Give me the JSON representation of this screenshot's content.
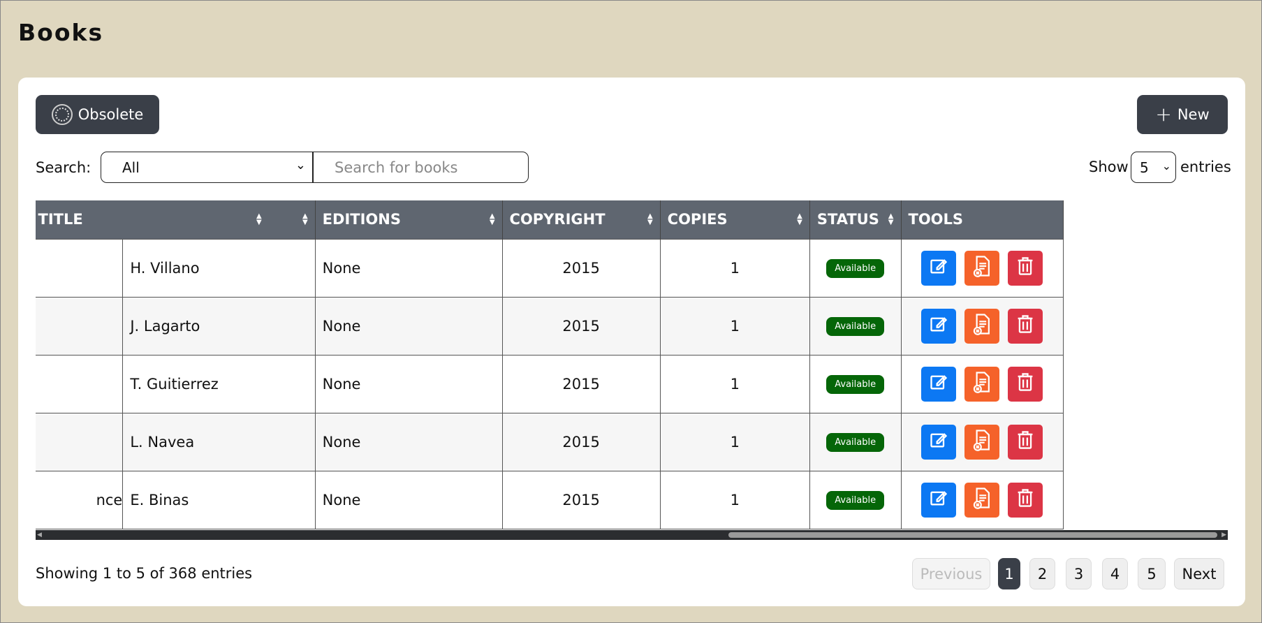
{
  "page": {
    "title": "Books"
  },
  "toolbar": {
    "obsolete_label": "Obsolete",
    "new_label": "New"
  },
  "search": {
    "label": "Search:",
    "filter_value": "All",
    "placeholder": "Search for books"
  },
  "show_entries": {
    "prefix": "Show",
    "value": "5",
    "suffix": "entries"
  },
  "table": {
    "headers": {
      "title": "TITLE",
      "editions": "EDITIONS",
      "copyright": "COPYRIGHT",
      "copies": "COPIES",
      "status": "STATUS",
      "tools": "TOOLS"
    },
    "rows": [
      {
        "title_fragment": "",
        "author": "H. Villano",
        "editions": "None",
        "copyright": "2015",
        "copies": "1",
        "status": "Available"
      },
      {
        "title_fragment": "",
        "author": "J. Lagarto",
        "editions": "None",
        "copyright": "2015",
        "copies": "1",
        "status": "Available"
      },
      {
        "title_fragment": "",
        "author": "T. Guitierrez",
        "editions": "None",
        "copyright": "2015",
        "copies": "1",
        "status": "Available"
      },
      {
        "title_fragment": "",
        "author": "L. Navea",
        "editions": "None",
        "copyright": "2015",
        "copies": "1",
        "status": "Available"
      },
      {
        "title_fragment": "nce",
        "author": "E. Binas",
        "editions": "None",
        "copyright": "2015",
        "copies": "1",
        "status": "Available"
      }
    ]
  },
  "footer": {
    "info": "Showing 1 to 5 of 368 entries",
    "pagination": {
      "previous": "Previous",
      "pages": [
        "1",
        "2",
        "3",
        "4",
        "5"
      ],
      "next": "Next",
      "current": "1"
    }
  },
  "colors": {
    "background": "#dfd7bf",
    "header": "#5f6670",
    "dark_button": "#3a3f48",
    "status_available": "#056608",
    "edit": "#0c78f3",
    "obsolete": "#f5622a",
    "delete": "#dc3545"
  },
  "icons": {
    "obsolete": "obsolete-icon",
    "new": "plus-icon",
    "edit": "edit-icon",
    "mark_obsolete": "document-remove-icon",
    "delete": "trash-icon",
    "sort": "sort-icon"
  }
}
